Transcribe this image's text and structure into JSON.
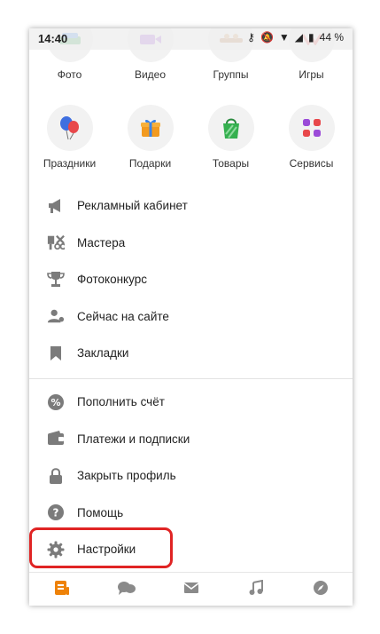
{
  "status_bar": {
    "time": "14:40",
    "battery": "44 %"
  },
  "top_partial_labels": [
    "Фото",
    "Видео",
    "Группы",
    "Игры"
  ],
  "grid": [
    {
      "label": "Праздники",
      "icon": "balloons-icon"
    },
    {
      "label": "Подарки",
      "icon": "gift-icon"
    },
    {
      "label": "Товары",
      "icon": "shopping-bag-icon"
    },
    {
      "label": "Сервисы",
      "icon": "services-grid-icon"
    }
  ],
  "menu_section_1": [
    {
      "label": "Рекламный кабинет",
      "icon": "megaphone-icon"
    },
    {
      "label": "Мастера",
      "icon": "masters-tools-icon"
    },
    {
      "label": "Фотоконкурс",
      "icon": "trophy-icon"
    },
    {
      "label": "Сейчас на сайте",
      "icon": "online-users-icon"
    },
    {
      "label": "Закладки",
      "icon": "bookmark-icon"
    }
  ],
  "menu_section_2": [
    {
      "label": "Пополнить счёт",
      "icon": "top-up-icon"
    },
    {
      "label": "Платежи и подписки",
      "icon": "wallet-icon"
    },
    {
      "label": "Закрыть профиль",
      "icon": "lock-icon"
    },
    {
      "label": "Помощь",
      "icon": "help-icon"
    },
    {
      "label": "Настройки",
      "icon": "gear-icon"
    }
  ],
  "tabbar": [
    "feed-icon",
    "chat-icon",
    "mail-icon",
    "music-icon",
    "discover-icon"
  ],
  "colors": {
    "accent": "#ee8208",
    "gray_icon": "#7b7b7b",
    "highlight": "#e02424"
  }
}
